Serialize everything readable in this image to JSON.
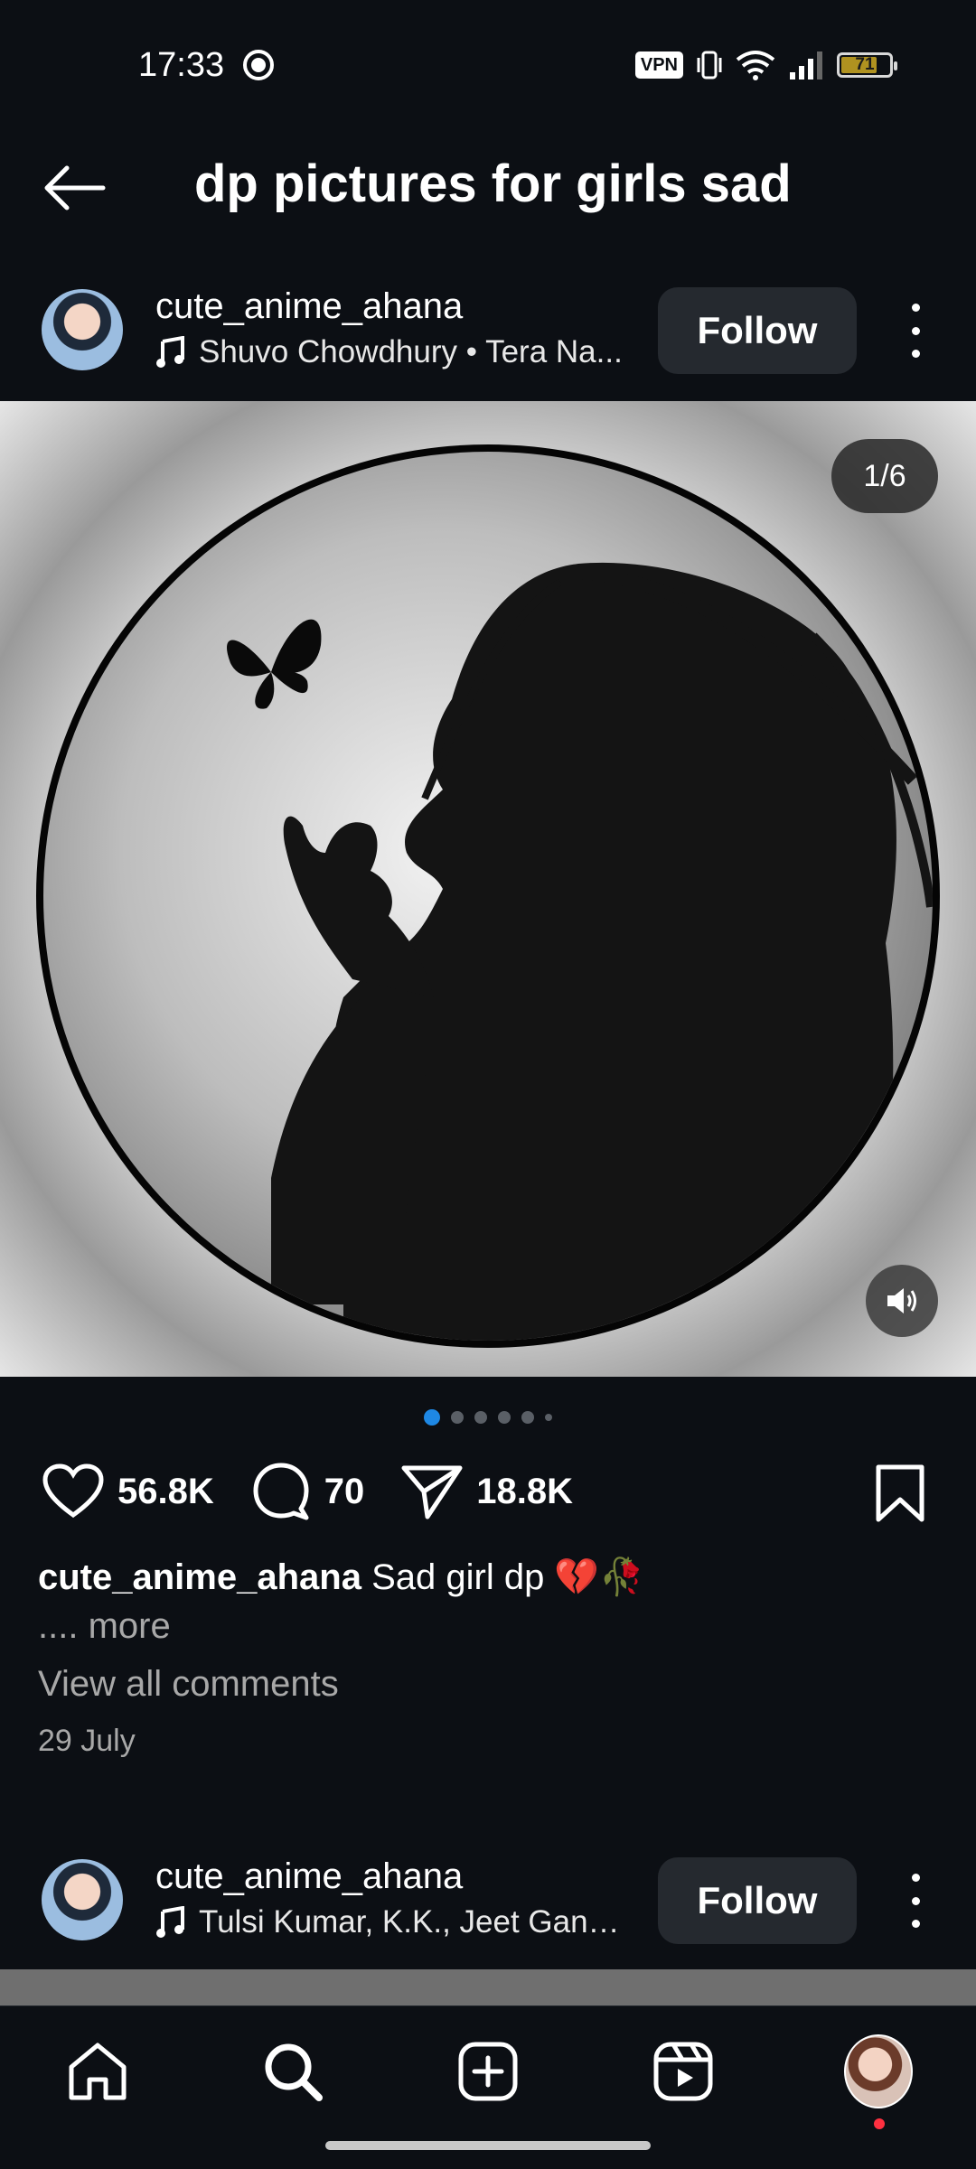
{
  "status_bar": {
    "time": "17:33",
    "vpn_label": "VPN",
    "battery_level": "71",
    "icons": [
      "record-icon",
      "vibrate-icon",
      "wifi-icon",
      "signal-icon",
      "battery-icon"
    ]
  },
  "header": {
    "title": "dp pictures for girls sad"
  },
  "posts": [
    {
      "username": "cute_anime_ahana",
      "music": "Shuvo Chowdhury • Tera Na...",
      "follow_label": "Follow",
      "image_counter": "1/6",
      "likes": "56.8K",
      "comments": "70",
      "shares": "18.8K",
      "caption_user": "cute_anime_ahana",
      "caption_text": "Sad girl dp 💔🥀",
      "more_label": ".... more",
      "view_comments": "View all comments",
      "date": "29 July",
      "carousel": {
        "total": 6,
        "active": 1
      }
    },
    {
      "username": "cute_anime_ahana",
      "music": "Tulsi Kumar, K.K., Jeet Gang...",
      "follow_label": "Follow"
    }
  ],
  "bottom_nav": {
    "items": [
      "home-icon",
      "search-icon",
      "create-icon",
      "reels-icon",
      "profile-avatar"
    ]
  },
  "colors": {
    "background": "#0c0f14",
    "button": "#25292f",
    "accent_blue": "#1e88e5",
    "notification": "#ff3040"
  }
}
